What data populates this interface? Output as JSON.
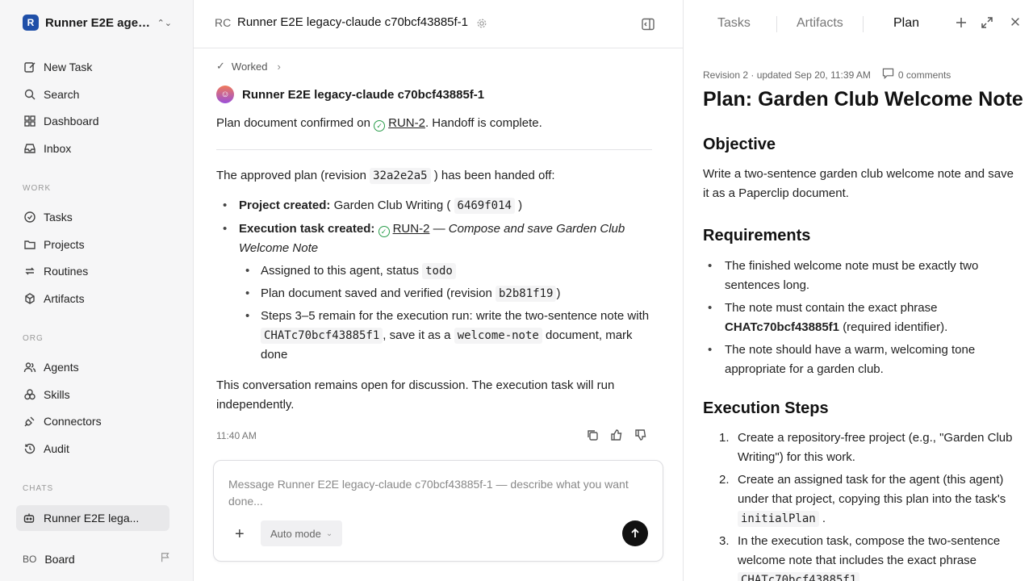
{
  "sidebar": {
    "workspace": {
      "logo": "R",
      "name": "Runner E2E agen..."
    },
    "main_nav": [
      {
        "icon": "pencil-square-icon",
        "label": "New Task"
      },
      {
        "icon": "search-icon",
        "label": "Search"
      },
      {
        "icon": "dashboard-icon",
        "label": "Dashboard"
      },
      {
        "icon": "inbox-icon",
        "label": "Inbox"
      }
    ],
    "work_label": "WORK",
    "work_nav": [
      {
        "icon": "check-circle-icon",
        "label": "Tasks"
      },
      {
        "icon": "folder-icon",
        "label": "Projects"
      },
      {
        "icon": "repeat-icon",
        "label": "Routines"
      },
      {
        "icon": "cube-icon",
        "label": "Artifacts"
      }
    ],
    "org_label": "ORG",
    "org_nav": [
      {
        "icon": "users-icon",
        "label": "Agents"
      },
      {
        "icon": "skills-icon",
        "label": "Skills"
      },
      {
        "icon": "plug-icon",
        "label": "Connectors"
      },
      {
        "icon": "history-icon",
        "label": "Audit"
      }
    ],
    "chats_label": "CHATS",
    "active_chat": "Runner E2E lega...",
    "board": {
      "initials": "BO",
      "label": "Board"
    }
  },
  "chat": {
    "header_initials": "RC",
    "header_title": "Runner E2E legacy-claude c70bcf43885f-1",
    "worked_label": "Worked",
    "agent_name": "Runner E2E legacy-claude c70bcf43885f-1",
    "confirm_prefix": "Plan document confirmed on",
    "confirm_link": "RUN-2",
    "confirm_suffix": ". Handoff is complete.",
    "handoff_prefix": "The approved plan (revision",
    "handoff_rev": "32a2e2a5",
    "handoff_suffix": ") has been handed off:",
    "b1_label": "Project created:",
    "b1_text": "Garden Club Writing (",
    "b1_code": "6469f014",
    "b1_end": ")",
    "b2_label": "Execution task created:",
    "b2_link": "RUN-2",
    "b2_dash": " — ",
    "b2_italic": "Compose and save Garden Club Welcome Note",
    "s1_text": "Assigned to this agent, status",
    "s1_code": "todo",
    "s2_text": "Plan document saved and verified (revision",
    "s2_code": "b2b81f19",
    "s2_end": ")",
    "s3_text": "Steps 3–5 remain for the execution run: write the two-sentence note with",
    "s3_code1": "CHATc70bcf43885f1",
    "s3_mid": ", save it as a",
    "s3_code2": "welcome-note",
    "s3_end": "document, mark done",
    "closing": "This conversation remains open for discussion. The execution task will run independently.",
    "time": "11:40 AM",
    "composer_placeholder": "Message Runner E2E legacy-claude c70bcf43885f-1 — describe what you want done...",
    "mode_label": "Auto mode"
  },
  "panel": {
    "tabs": [
      "Tasks",
      "Artifacts",
      "Plan"
    ],
    "active_tab": "Plan",
    "meta": "Revision 2 · updated Sep 20, 11:39 AM",
    "comments": "0 comments",
    "title": "Plan: Garden Club Welcome Note",
    "objective_heading": "Objective",
    "objective_text": "Write a two-sentence garden club welcome note and save it as a Paperclip document.",
    "requirements_heading": "Requirements",
    "req1": "The finished welcome note must be exactly two sentences long.",
    "req2_prefix": "The note must contain the exact phrase",
    "req2_bold": "CHATc70bcf43885f1",
    "req2_suffix": "(required identifier).",
    "req3": "The note should have a warm, welcoming tone appropriate for a garden club.",
    "steps_heading": "Execution Steps",
    "step1": "Create a repository-free project (e.g., \"Garden Club Writing\") for this work.",
    "step2_prefix": "Create an assigned task for the agent (this agent) under that project, copying this plan into the task's",
    "step2_code": "initialPlan",
    "step2_suffix": ".",
    "step3_prefix": "In the execution task, compose the two-sentence welcome note that includes the exact phrase",
    "step3_code": "CHATc70bcf43885f1"
  }
}
